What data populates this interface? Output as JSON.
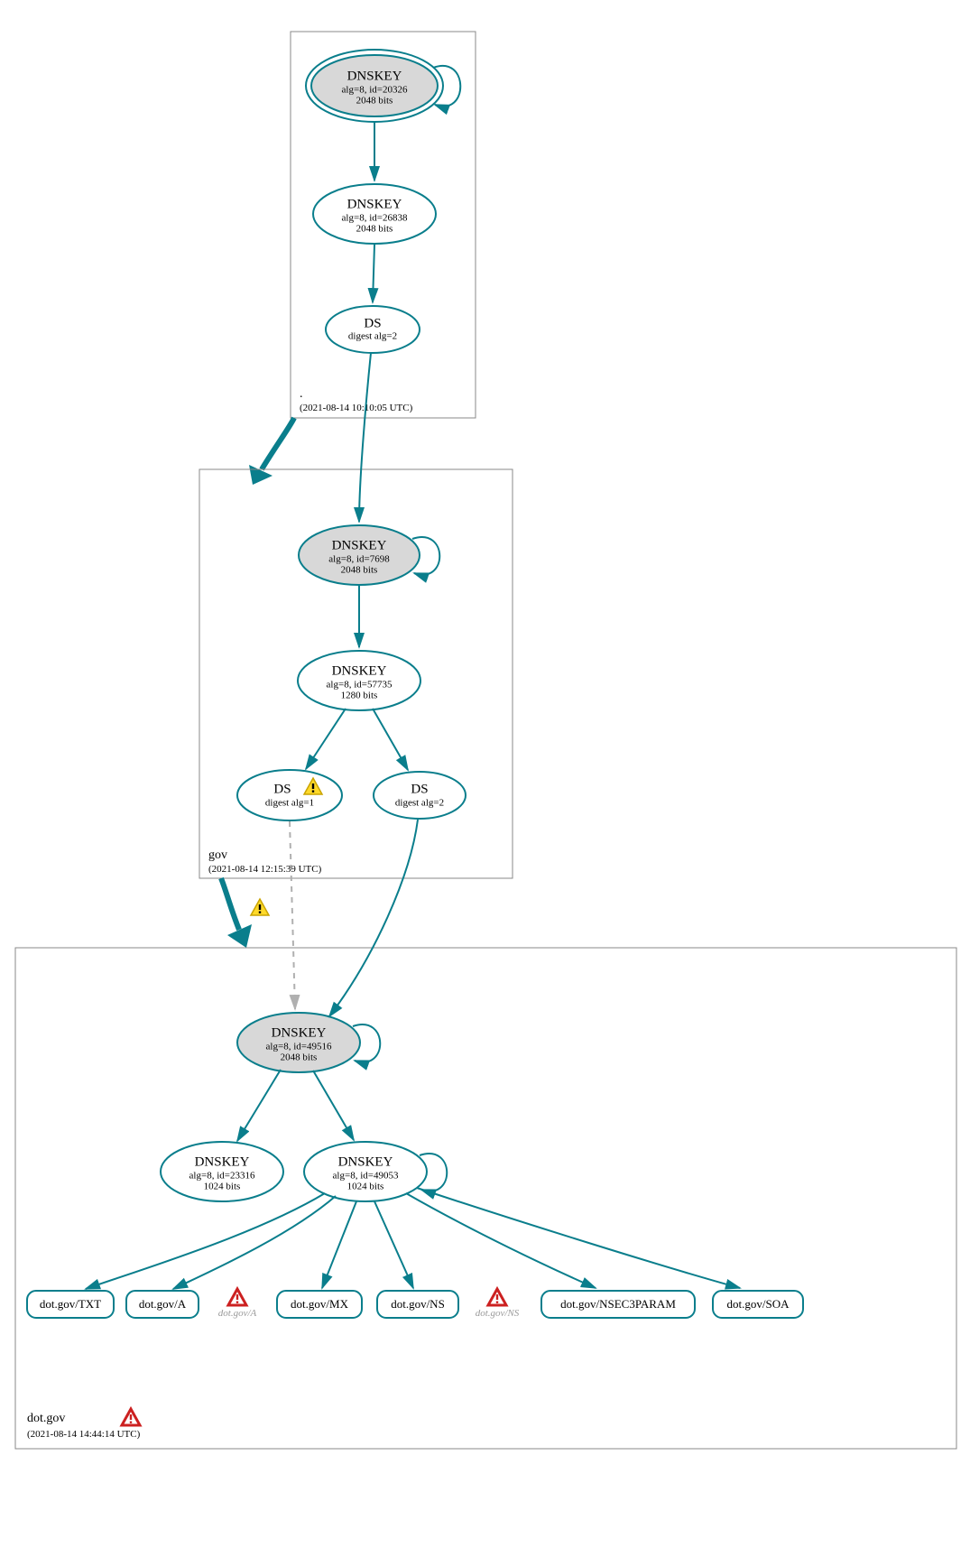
{
  "colors": {
    "accent": "#0a7e8c",
    "ksk_fill": "#d8d8d8"
  },
  "zones": {
    "root": {
      "label": ".",
      "timestamp": "(2021-08-14 10:10:05 UTC)"
    },
    "gov": {
      "label": "gov",
      "timestamp": "(2021-08-14 12:15:39 UTC)"
    },
    "dotgov": {
      "label": "dot.gov",
      "timestamp": "(2021-08-14 14:44:14 UTC)"
    }
  },
  "nodes": {
    "root_ksk": {
      "title": "DNSKEY",
      "l1": "alg=8, id=20326",
      "l2": "2048 bits",
      "ksk": true,
      "double": true,
      "selfloop": true
    },
    "root_zsk": {
      "title": "DNSKEY",
      "l1": "alg=8, id=26838",
      "l2": "2048 bits"
    },
    "root_ds": {
      "title": "DS",
      "l1": "digest alg=2"
    },
    "gov_ksk": {
      "title": "DNSKEY",
      "l1": "alg=8, id=7698",
      "l2": "2048 bits",
      "ksk": true,
      "selfloop": true
    },
    "gov_zsk": {
      "title": "DNSKEY",
      "l1": "alg=8, id=57735",
      "l2": "1280 bits"
    },
    "gov_ds1": {
      "title": "DS",
      "l1": "digest alg=1",
      "warn": true
    },
    "gov_ds2": {
      "title": "DS",
      "l1": "digest alg=2"
    },
    "dg_ksk": {
      "title": "DNSKEY",
      "l1": "alg=8, id=49516",
      "l2": "2048 bits",
      "ksk": true,
      "selfloop": true
    },
    "dg_zsk1": {
      "title": "DNSKEY",
      "l1": "alg=8, id=23316",
      "l2": "1024 bits"
    },
    "dg_zsk2": {
      "title": "DNSKEY",
      "l1": "alg=8, id=49053",
      "l2": "1024 bits",
      "selfloop": true
    }
  },
  "leaves": {
    "txt": "dot.gov/TXT",
    "a": "dot.gov/A",
    "mx": "dot.gov/MX",
    "ns": "dot.gov/NS",
    "nsec3": "dot.gov/NSEC3PARAM",
    "soa": "dot.gov/SOA"
  },
  "ghosts": {
    "a": "dot.gov/A",
    "ns": "dot.gov/NS"
  }
}
